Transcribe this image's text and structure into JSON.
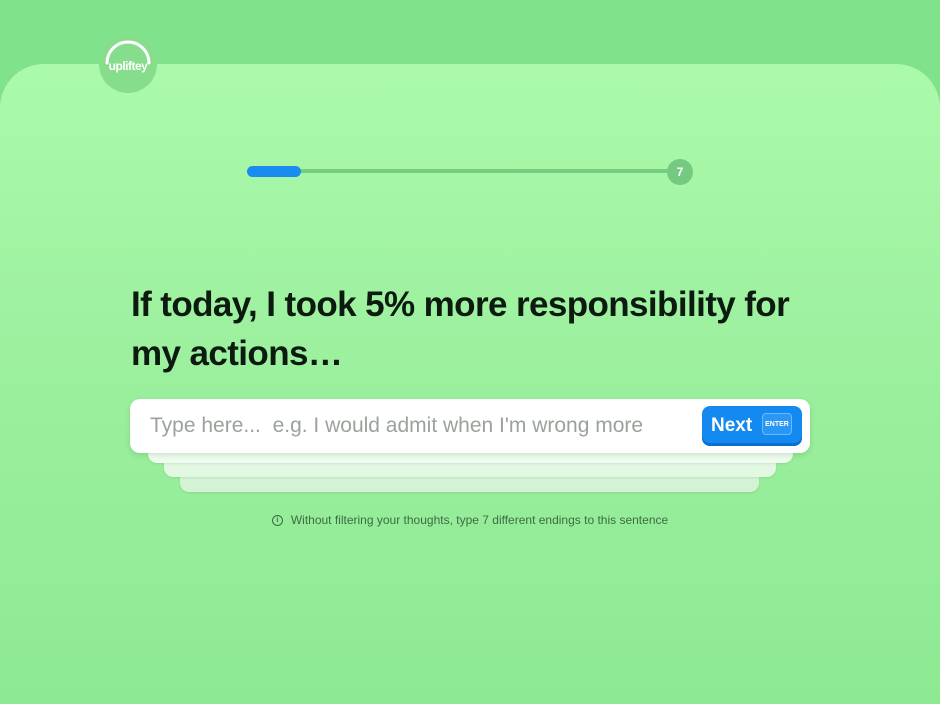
{
  "brand": {
    "logo_text": "upliftey"
  },
  "progress": {
    "fraction": 0.125,
    "step_label": "7"
  },
  "question": {
    "text": "If today, I took 5% more responsibility for my actions…"
  },
  "answer": {
    "value": "",
    "placeholder": "Type here...  e.g. I would admit when I'm wrong more"
  },
  "next_button": {
    "label": "Next",
    "key_hint": "ENTER"
  },
  "hint": {
    "icon": "info-icon",
    "text": "Without filtering your thoughts, type 7 different endings to this sentence"
  },
  "colors": {
    "background": "#80e38c",
    "card": "#abfaab",
    "accent": "#1489f0",
    "heading": "#0c1a10"
  }
}
